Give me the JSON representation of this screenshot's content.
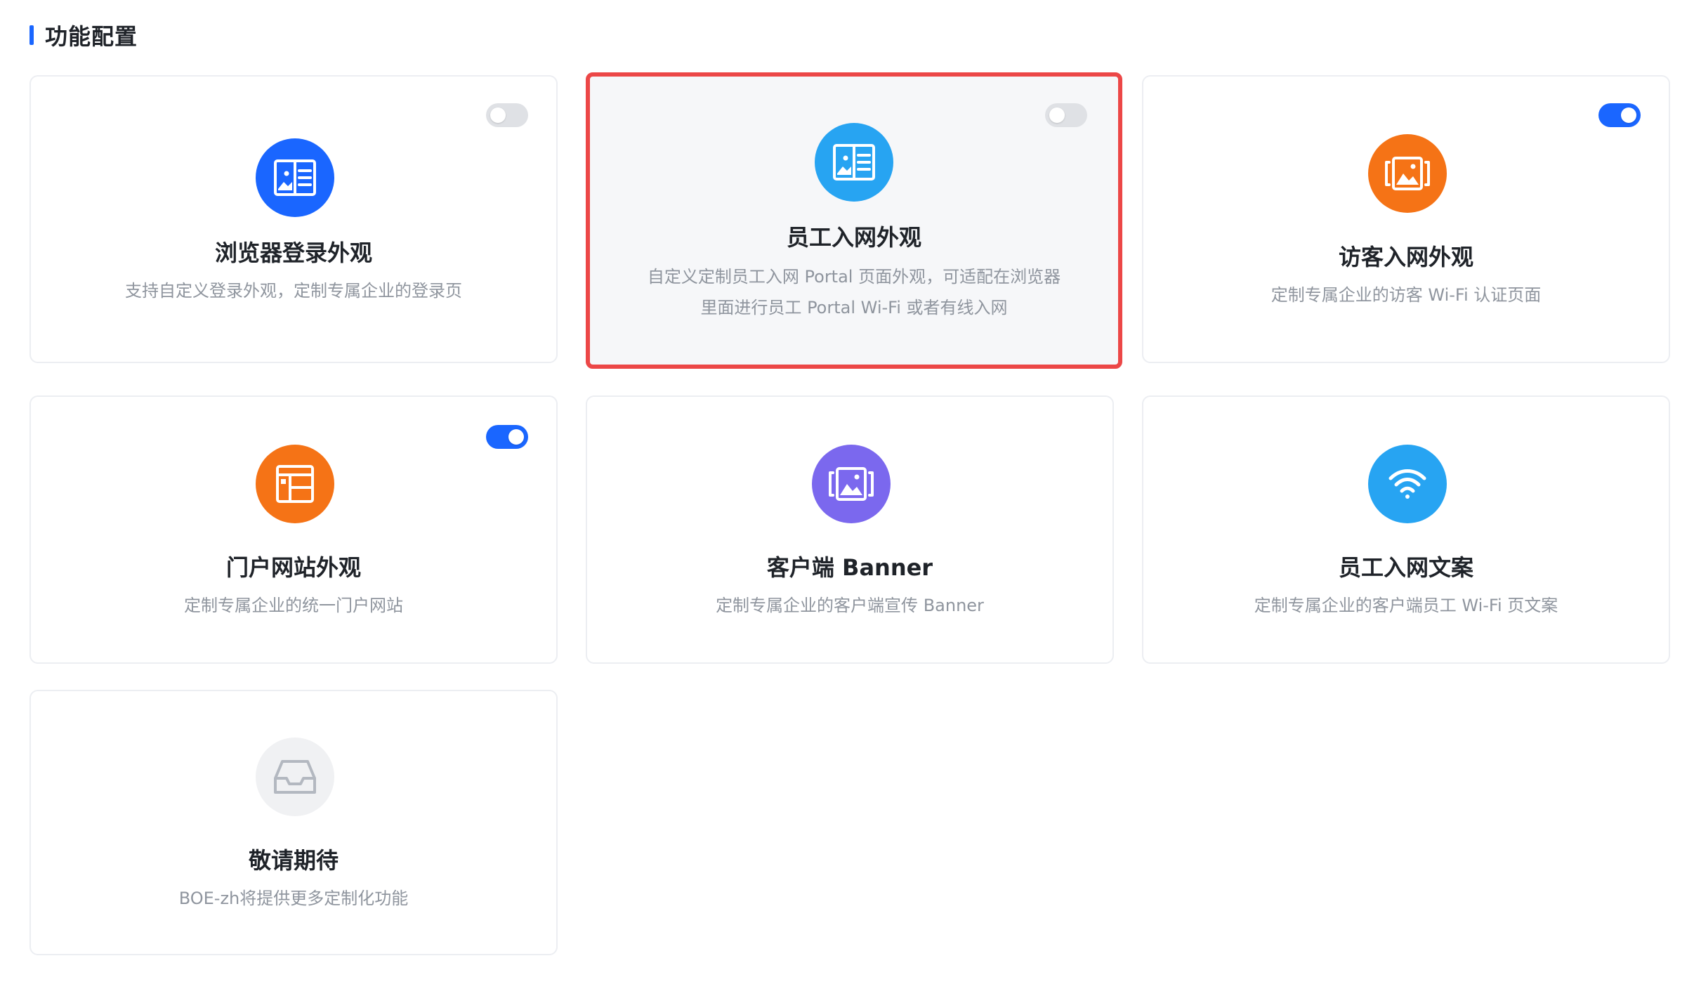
{
  "section": {
    "title": "功能配置",
    "accent": "#1a66ff"
  },
  "cards": [
    {
      "title": "浏览器登录外观",
      "desc": [
        "支持自定义登录外观，定制专属企业的登录页"
      ],
      "icon": "browser-layout-icon",
      "icon_color": "#1a66ff",
      "toggle": "off"
    },
    {
      "title": "员工入网外观",
      "desc": [
        "自定义定制员工入网 Portal 页面外观，可适配在浏览器",
        "里面进行员工 Portal Wi-Fi 或者有线入网"
      ],
      "icon": "browser-layout-icon",
      "icon_color": "#27a4f2",
      "toggle": "off",
      "selected": true,
      "highlight_color": "#ec4747"
    },
    {
      "title": "访客入网外观",
      "desc": [
        "定制专属企业的访客 Wi-Fi 认证页面"
      ],
      "icon": "image-frame-icon",
      "icon_color": "#f57316",
      "toggle": "on"
    },
    {
      "title": "门户网站外观",
      "desc": [
        "定制专属企业的统一门户网站"
      ],
      "icon": "layout-grid-icon",
      "icon_color": "#f57316",
      "toggle": "on"
    },
    {
      "title": "客户端 Banner",
      "desc": [
        "定制专属企业的客户端宣传 Banner"
      ],
      "icon": "image-frame-icon",
      "icon_color": "#7b68ee"
    },
    {
      "title": "员工入网文案",
      "desc": [
        "定制专属企业的客户端员工 Wi-Fi 页文案"
      ],
      "icon": "wifi-icon",
      "icon_color": "#27a4f2"
    },
    {
      "title": "敬请期待",
      "desc": [
        "BOE-zh将提供更多定制化功能"
      ],
      "icon": "inbox-icon",
      "icon_color": "#f0f1f3"
    }
  ]
}
